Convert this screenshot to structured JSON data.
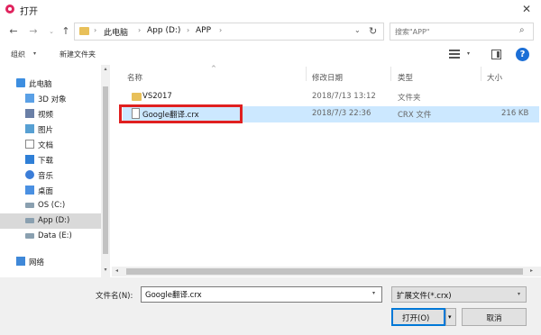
{
  "window": {
    "title": "打开",
    "close_icon": "✕"
  },
  "nav": {
    "back_icon": "←",
    "forward_icon": "→",
    "recent_icon": "⌄",
    "up_icon": "↑",
    "breadcrumbs": [
      "此电脑",
      "App (D:)",
      "APP"
    ],
    "chevron": "›",
    "dropdown_icon": "⌄",
    "refresh_icon": "↻",
    "search_placeholder": "搜索\"APP\"",
    "search_icon": "⌕"
  },
  "toolbar": {
    "organize_label": "组织",
    "organize_chevron": "▾",
    "new_folder_label": "新建文件夹",
    "view_chevron": "▾",
    "help_label": "?"
  },
  "sidebar": {
    "items": [
      {
        "label": "此电脑",
        "icon": "pc-icon"
      },
      {
        "label": "3D 对象",
        "icon": "3d-objects-icon"
      },
      {
        "label": "视频",
        "icon": "video-icon"
      },
      {
        "label": "图片",
        "icon": "pictures-icon"
      },
      {
        "label": "文档",
        "icon": "documents-icon"
      },
      {
        "label": "下载",
        "icon": "downloads-icon"
      },
      {
        "label": "音乐",
        "icon": "music-icon"
      },
      {
        "label": "桌面",
        "icon": "desktop-icon"
      },
      {
        "label": "OS (C:)",
        "icon": "drive-icon"
      },
      {
        "label": "App (D:)",
        "icon": "drive-icon",
        "selected": true
      },
      {
        "label": "Data (E:)",
        "icon": "drive-icon"
      },
      {
        "label": "网络",
        "icon": "network-icon"
      }
    ],
    "scroll_up": "▴",
    "scroll_down": "▾"
  },
  "files": {
    "columns": [
      "名称",
      "修改日期",
      "类型",
      "大小"
    ],
    "sort_indicator": "^",
    "rows": [
      {
        "name": "VS2017",
        "modified": "2018/7/13 13:12",
        "type": "文件夹",
        "size": "",
        "icon": "folder-icon"
      },
      {
        "name": "Google翻译.crx",
        "modified": "2018/7/3 22:36",
        "type": "CRX 文件",
        "size": "216 KB",
        "icon": "file-icon",
        "selected": true
      }
    ],
    "scroll_left": "◂",
    "scroll_right": "▸"
  },
  "footer": {
    "filename_label": "文件名(N):",
    "filename_value": "Google翻译.crx",
    "filename_chevron": "▾",
    "filetype_value": "扩展文件(*.crx)",
    "filetype_chevron": "▾",
    "open_label": "打开(O)",
    "open_split_icon": "▾",
    "cancel_label": "取消"
  },
  "colors": {
    "selection": "#cce8ff",
    "highlight_box": "#e02020",
    "accent": "#0078d7",
    "folder": "#e8c05a"
  }
}
